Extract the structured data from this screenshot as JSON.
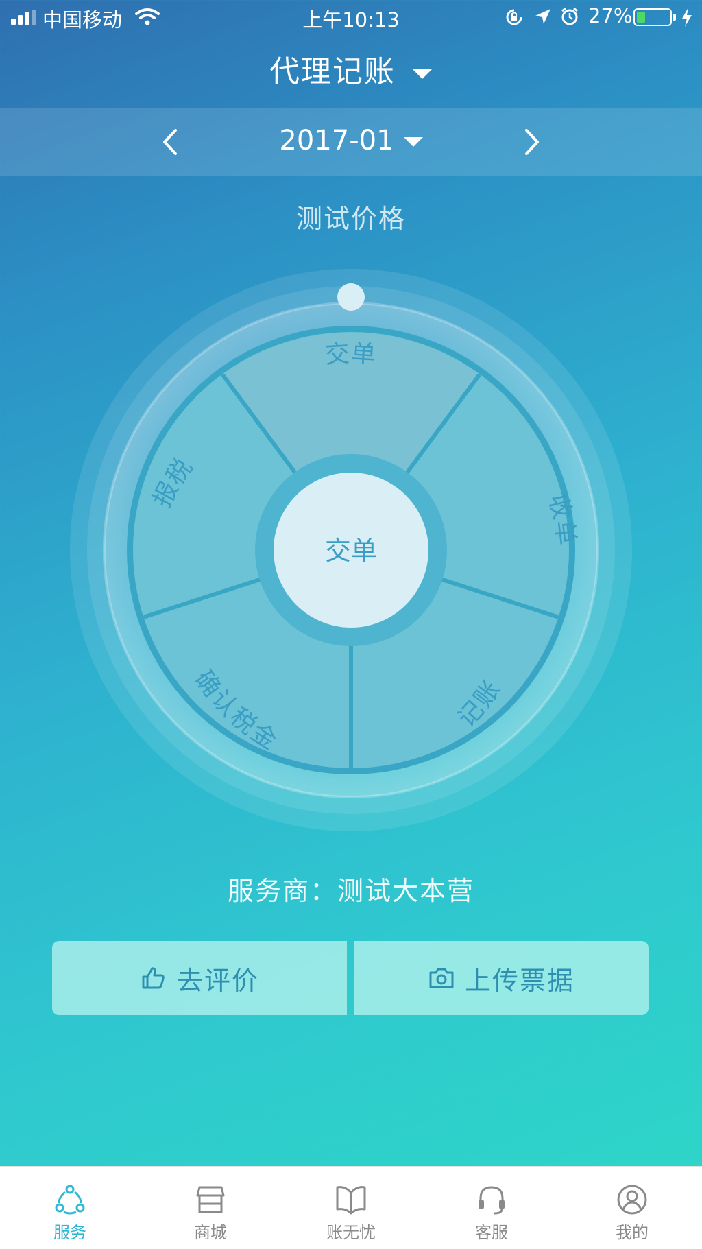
{
  "status_bar": {
    "carrier": "中国移动",
    "time": "上午10:13",
    "battery_percent_text": "27%",
    "battery_level": 0.27,
    "signal_icon": "cellular-signal-icon",
    "wifi_icon": "wifi-icon",
    "orientation_lock_icon": "orientation-lock-icon",
    "location_icon": "location-arrow-icon",
    "alarm_icon": "alarm-clock-icon",
    "charging_icon": "charging-bolt-icon"
  },
  "header": {
    "title": "代理记账",
    "dropdown_icon": "caret-down-icon"
  },
  "date_selector": {
    "value": "2017-01",
    "prev_icon": "chevron-left-icon",
    "next_icon": "chevron-right-icon",
    "dropdown_icon": "caret-down-icon"
  },
  "plan_name": "测试价格",
  "wheel": {
    "center_label": "交单",
    "segments": [
      {
        "label": "交单"
      },
      {
        "label": "收单"
      },
      {
        "label": "记账"
      },
      {
        "label": "确认税金"
      },
      {
        "label": "报税"
      }
    ],
    "current_step": "交单"
  },
  "provider": {
    "text": "服务商：测试大本营"
  },
  "actions": {
    "review_label": "去评价",
    "review_icon": "thumbs-up-icon",
    "upload_label": "上传票据",
    "upload_icon": "camera-icon"
  },
  "tabbar": {
    "active_index": 0,
    "tabs": [
      {
        "label": "服务",
        "icon": "service-network-icon"
      },
      {
        "label": "商城",
        "icon": "store-icon"
      },
      {
        "label": "账无忧",
        "icon": "open-book-icon"
      },
      {
        "label": "客服",
        "icon": "headset-icon"
      },
      {
        "label": "我的",
        "icon": "user-profile-icon"
      }
    ]
  },
  "colors": {
    "accent": "#2fb8d4",
    "button_text": "#2f8fb0",
    "wheel_text": "#3a9ec4",
    "tab_inactive": "#8a8a8a"
  }
}
